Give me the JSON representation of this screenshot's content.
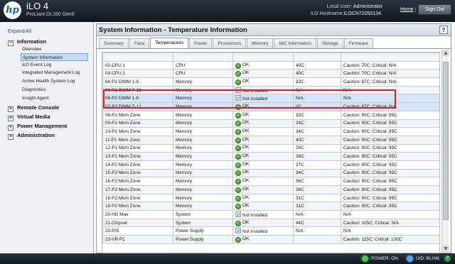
{
  "header": {
    "product_title": "iLO 4",
    "product_sub": "ProLiant DL160 Gen8",
    "local_user_label": "Local User:",
    "local_user_value": "Administrator",
    "hostname_label": "iLO Hostname:",
    "hostname_value": "ILOCN72050134.",
    "home": "Home",
    "separator": "|",
    "sign_out": "Sign Out",
    "logo_text": "hp"
  },
  "nav": {
    "expand_all": "Expand All",
    "sections": [
      {
        "label": "Information",
        "expanded": true
      },
      {
        "label": "Remote Console",
        "expanded": false
      },
      {
        "label": "Virtual Media",
        "expanded": false
      },
      {
        "label": "Power Management",
        "expanded": false
      },
      {
        "label": "Administration",
        "expanded": false
      }
    ],
    "items": [
      "Overview",
      "System Information",
      "iLO Event Log",
      "Integrated Management Log",
      "Active Health System Log",
      "Diagnostics",
      "Insight Agent"
    ],
    "selected": "System Information"
  },
  "panel": {
    "title": "System Information - Temperature Information",
    "help": "?",
    "tabs": [
      "Summary",
      "Fans",
      "Temperatures",
      "Power",
      "Processors",
      "Memory",
      "NIC Information",
      "Storage",
      "Firmware"
    ],
    "active_tab": "Temperatures"
  },
  "table": {
    "rows": [
      {
        "sensor": "",
        "location": "",
        "status": "",
        "reading": "",
        "thresholds": ""
      },
      {
        "sensor": "02-CPU 1",
        "location": "CPU",
        "status": "OK",
        "reading": "40C",
        "thresholds": "Caution: 70C; Critical: N/A"
      },
      {
        "sensor": "03-CPU 2",
        "location": "CPU",
        "status": "OK",
        "reading": "40C",
        "thresholds": "Caution: 70C; Critical: N/A"
      },
      {
        "sensor": "04-P1 DIMM 1-6",
        "location": "Memory",
        "status": "OK",
        "reading": "33C",
        "thresholds": "Caution: 87C; Critical: N/A"
      },
      {
        "sensor": "05-P1 DIMM 7-12",
        "location": "Memory",
        "status": "Not installed",
        "reading": "N/A",
        "thresholds": "N/A"
      },
      {
        "sensor": "06-P2 DIMM 1-6",
        "location": "Memory",
        "status": "Not installed",
        "reading": "N/A",
        "thresholds": "N/A"
      },
      {
        "sensor": "07-P2 DIMM 7-12",
        "location": "Memory",
        "status": "OK",
        "reading": "0C",
        "thresholds": "Caution: 87C; Critical: N/A"
      },
      {
        "sensor": "08-P1 Mem Zone",
        "location": "Memory",
        "status": "OK",
        "reading": "33C",
        "thresholds": "Caution: 90C; Critical: 95C"
      },
      {
        "sensor": "09-P1 Mem Zone",
        "location": "Memory",
        "status": "OK",
        "reading": "33C",
        "thresholds": "Caution: 90C; Critical: 95C"
      },
      {
        "sensor": "10-P1 Mem Zone",
        "location": "Memory",
        "status": "OK",
        "reading": "34C",
        "thresholds": "Caution: 90C; Critical: 95C"
      },
      {
        "sensor": "11-P1 Mem Zone",
        "location": "Memory",
        "status": "OK",
        "reading": "40C",
        "thresholds": "Caution: 90C; Critical: 95C"
      },
      {
        "sensor": "12-P1 Mem Zone",
        "location": "Memory",
        "status": "OK",
        "reading": "39C",
        "thresholds": "Caution: 90C; Critical: 95C"
      },
      {
        "sensor": "13-P1 Mem Zone",
        "location": "Memory",
        "status": "OK",
        "reading": "38C",
        "thresholds": "Caution: 90C; Critical: 95C"
      },
      {
        "sensor": "14-P2 Mem Zone",
        "location": "Memory",
        "status": "OK",
        "reading": "37C",
        "thresholds": "Caution: 90C; Critical: 95C"
      },
      {
        "sensor": "15-P2 Mem Zone",
        "location": "Memory",
        "status": "OK",
        "reading": "34C",
        "thresholds": "Caution: 90C; Critical: 95C"
      },
      {
        "sensor": "16-P2 Mem Zone",
        "location": "Memory",
        "status": "OK",
        "reading": "36C",
        "thresholds": "Caution: 90C; Critical: 95C"
      },
      {
        "sensor": "17-P2 Mem Zone",
        "location": "Memory",
        "status": "OK",
        "reading": "36C",
        "thresholds": "Caution: 90C; Critical: 95C"
      },
      {
        "sensor": "18-P2 Mem Zone",
        "location": "Memory",
        "status": "OK",
        "reading": "31C",
        "thresholds": "Caution: 90C; Critical: 95C"
      },
      {
        "sensor": "19-P2 Mem Zone",
        "location": "Memory",
        "status": "OK",
        "reading": "31C",
        "thresholds": "Caution: 90C; Critical: 95C"
      },
      {
        "sensor": "20-HD Max",
        "location": "System",
        "status": "Not installed",
        "reading": "N/A",
        "thresholds": "N/A"
      },
      {
        "sensor": "21-Chipset",
        "location": "System",
        "status": "OK",
        "reading": "44C",
        "thresholds": "Caution: 105C; Critical: N/A"
      },
      {
        "sensor": "22-P/S",
        "location": "Power Supply",
        "status": "Not installed",
        "reading": "N/A",
        "thresholds": "N/A"
      },
      {
        "sensor": "23-VR P1",
        "location": "Power Supply",
        "status": "OK",
        "reading": "",
        "thresholds": "Caution: 115C; Critical: 120C"
      }
    ],
    "highlighted_rows": [
      5,
      6
    ]
  },
  "status_bar": {
    "power_label": "POWER: ON",
    "uid_label": "UID: BLINK",
    "help_icon": "?",
    "colors": {
      "power_led": "#3fcf3f",
      "uid_led": "#4aa8ff"
    }
  }
}
